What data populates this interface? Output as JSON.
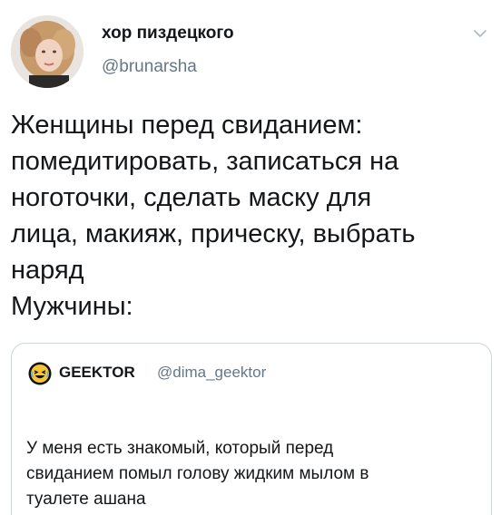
{
  "author": {
    "display_name": "хор пиздецкого",
    "handle": "@brunarsha"
  },
  "tweet": {
    "lines": [
      "Женщины перед свиданием:",
      "помедитировать, записаться на",
      "ноготочки, сделать маску для",
      "лица, макияж, прическу, выбрать",
      "наряд",
      "Мужчины:"
    ]
  },
  "quoted": {
    "display_name": "GEEKTOR",
    "handle": "@dima_geektor",
    "lines": [
      "У меня есть знакомый, который перед",
      "свиданием помыл голову жидким мылом в",
      "туалете ашана"
    ]
  },
  "icons": {
    "menu": "chevron-down-icon",
    "quoted_avatar": "laughing-emoji-icon"
  },
  "colors": {
    "text_primary": "#14171a",
    "text_secondary": "#657786",
    "card_border": "#ccd6dd"
  }
}
